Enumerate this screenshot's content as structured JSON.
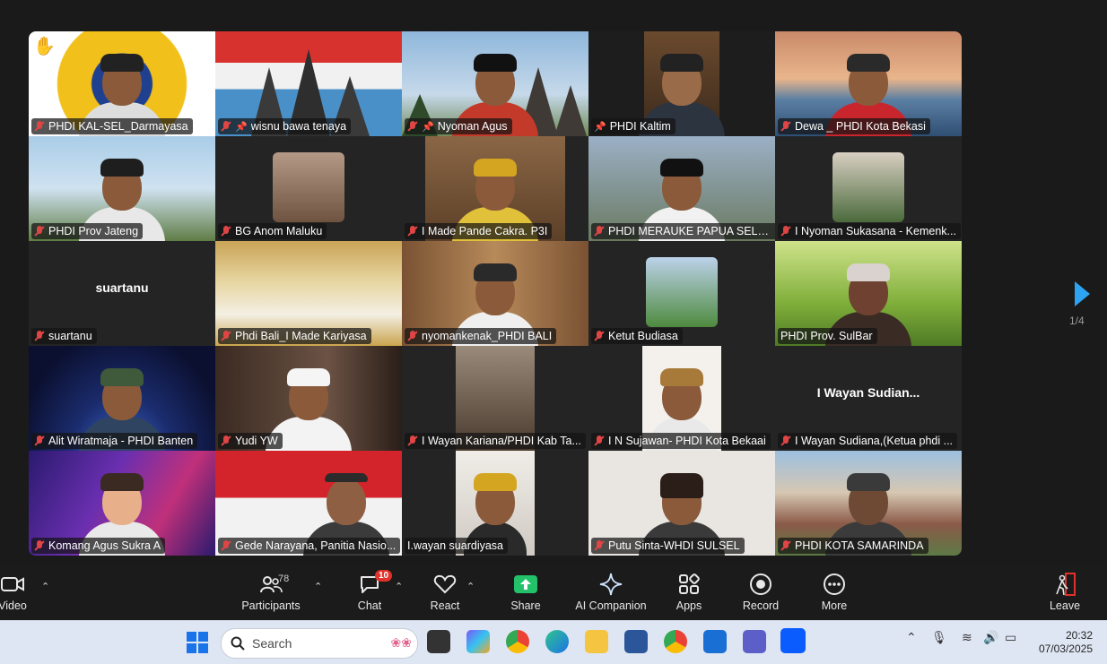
{
  "participants_grid": [
    {
      "name": "PHDI KAL-SEL_Darmayasa",
      "muted": true,
      "pinned": false,
      "hand": true
    },
    {
      "name": "wisnu bawa tenaya",
      "muted": true,
      "pinned": true
    },
    {
      "name": "Nyoman Agus",
      "muted": true,
      "pinned": true
    },
    {
      "name": "PHDI Kaltim",
      "muted": false,
      "pinned": true,
      "active": true
    },
    {
      "name": "Dewa _ PHDI Kota Bekasi",
      "muted": true
    },
    {
      "name": "PHDI Prov Jateng",
      "muted": true
    },
    {
      "name": "BG Anom Maluku",
      "muted": true
    },
    {
      "name": "I Made Pande Cakra. P3I",
      "muted": true
    },
    {
      "name": "PHDI MERAUKE PAPUA SELAT...",
      "muted": true
    },
    {
      "name": "I Nyoman Sukasana - Kemenk...",
      "muted": true
    },
    {
      "name": "suartanu",
      "muted": true,
      "bigname": "suartanu"
    },
    {
      "name": "Phdi Bali_I Made Kariyasa",
      "muted": true
    },
    {
      "name": "nyomankenak_PHDI BALI",
      "muted": true
    },
    {
      "name": "Ketut Budiasa",
      "muted": true
    },
    {
      "name": "PHDI Prov. SulBar",
      "muted": false
    },
    {
      "name": "Alit Wiratmaja - PHDI Banten",
      "muted": true
    },
    {
      "name": "Yudi YW",
      "muted": true
    },
    {
      "name": "I Wayan Kariana/PHDI Kab Ta...",
      "muted": true
    },
    {
      "name": "I N Sujawan- PHDI Kota Bekaai",
      "muted": true
    },
    {
      "name": "I Wayan Sudiana,(Ketua phdi ...",
      "muted": true,
      "bigname": "I Wayan Sudian..."
    },
    {
      "name": "Komang Agus Sukra A",
      "muted": true
    },
    {
      "name": "Gede Narayana, Panitia Nasio...",
      "muted": true
    },
    {
      "name": "I.wayan suardiyasa",
      "muted": false
    },
    {
      "name": "Putu Sinta-WHDI SULSEL",
      "muted": true
    },
    {
      "name": "PHDI KOTA SAMARINDA",
      "muted": true
    }
  ],
  "pagination": {
    "label": "1/4"
  },
  "toolbar": {
    "video": "Video",
    "participants": "Participants",
    "participants_count": "78",
    "chat": "Chat",
    "chat_badge": "10",
    "react": "React",
    "share": "Share",
    "ai_companion": "AI Companion",
    "apps": "Apps",
    "record": "Record",
    "more": "More",
    "leave": "Leave"
  },
  "taskbar": {
    "search_placeholder": "Search",
    "time": "20:32",
    "date": "07/03/2025"
  },
  "colors": {
    "active_speaker": "#2dd36f",
    "share_green": "#23c26a",
    "leave_red": "#e0322a",
    "next_arrow": "#2ea3f2"
  }
}
